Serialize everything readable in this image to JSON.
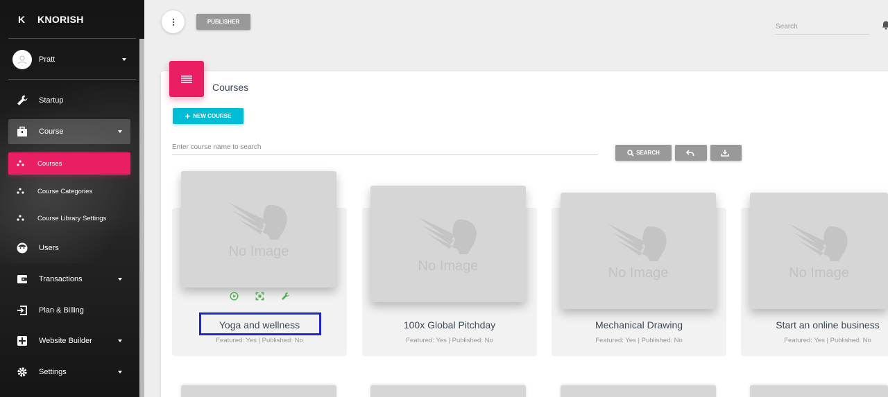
{
  "brand": {
    "mini": "K",
    "name": "KNORISH"
  },
  "user": {
    "name": "Pratt"
  },
  "nav": {
    "startup": "Startup",
    "course": "Course",
    "courses": "Courses",
    "course_categories": "Course Categories",
    "course_library_settings": "Course Library Settings",
    "users": "Users",
    "transactions": "Transactions",
    "plan_billing": "Plan & Billing",
    "website_builder": "Website Builder",
    "settings": "Settings"
  },
  "topbar": {
    "publisher_label": "PUBLISHER",
    "search_placeholder": "Search"
  },
  "page": {
    "title": "Courses",
    "new_course_label": "NEW COURSE",
    "course_search_placeholder": "Enter course name to search",
    "search_button_label": "SEARCH"
  },
  "courses": [
    {
      "name": "Yoga and wellness",
      "meta": "Featured: Yes | Published: No",
      "image_text": "No Image"
    },
    {
      "name": "100x Global Pitchday",
      "meta": "Featured: Yes | Published: No",
      "image_text": "No Image"
    },
    {
      "name": "Mechanical Drawing",
      "meta": "Featured: Yes | Published: No",
      "image_text": "No Image"
    },
    {
      "name": "Start an online business",
      "meta": "Featured: Yes | Published: No",
      "image_text": "No Image"
    }
  ],
  "colors": {
    "primary": "#e91e63",
    "info": "#00bcd4",
    "highlight": "#1f28c8",
    "action_green": "#4caf50"
  }
}
